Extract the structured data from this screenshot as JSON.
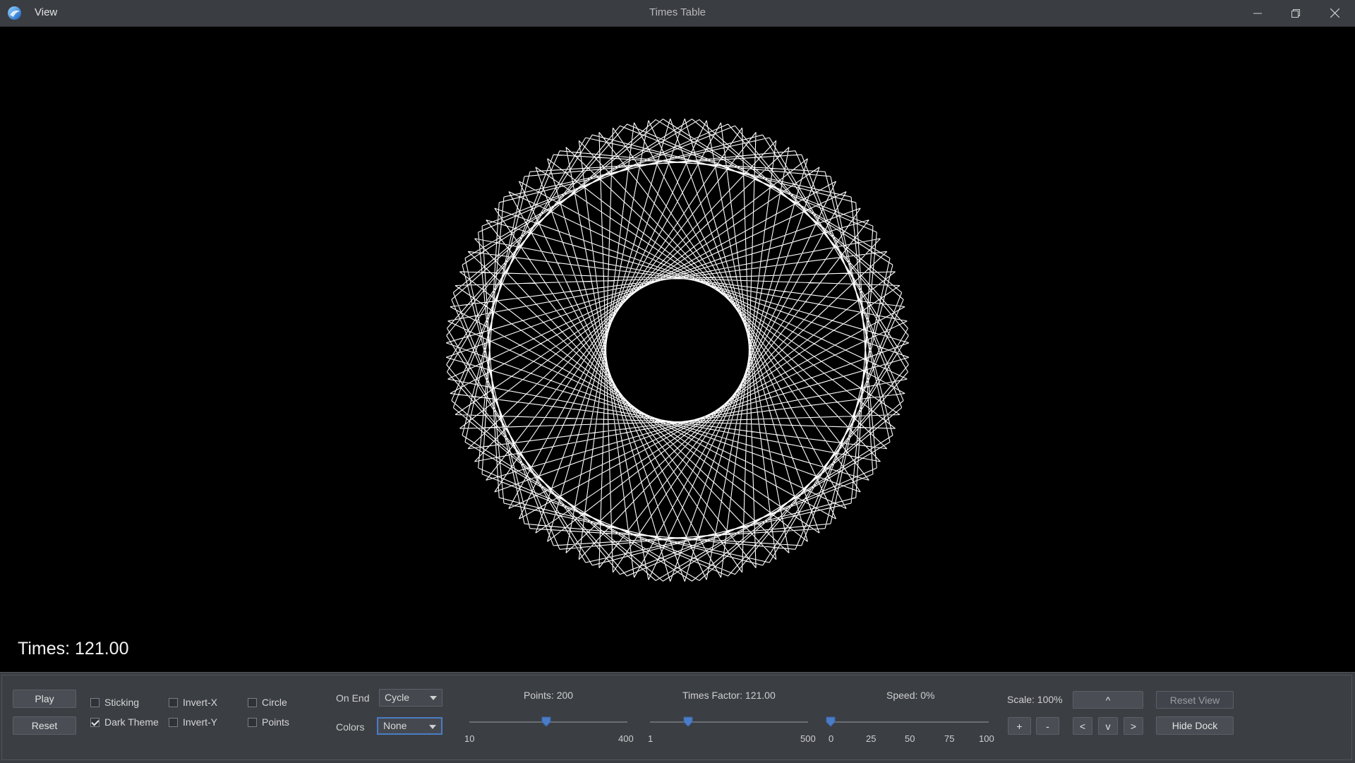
{
  "window": {
    "menu_view": "View",
    "title": "Times Table"
  },
  "canvas": {
    "times_text": "Times: 121.00",
    "points": 200,
    "times": 121,
    "stroke_color": "#ffffff",
    "background": "#000000"
  },
  "dock": {
    "play_label": "Play",
    "reset_label": "Reset",
    "checkboxes": {
      "sticking": {
        "label": "Sticking",
        "checked": false
      },
      "dark_theme": {
        "label": "Dark Theme",
        "checked": true
      },
      "invert_x": {
        "label": "Invert-X",
        "checked": false
      },
      "invert_y": {
        "label": "Invert-Y",
        "checked": false
      },
      "circle": {
        "label": "Circle",
        "checked": false
      },
      "points": {
        "label": "Points",
        "checked": false
      }
    },
    "on_end": {
      "label": "On End",
      "value": "Cycle"
    },
    "colors": {
      "label": "Colors",
      "value": "None"
    },
    "points_slider": {
      "label": "Points: 200",
      "min": "10",
      "max": "400",
      "value": 200
    },
    "times_slider": {
      "label": "Times Factor: 121.00",
      "min": "1",
      "max": "500",
      "value": 121
    },
    "speed_slider": {
      "label": "Speed: 0%",
      "ticks": [
        "0",
        "25",
        "50",
        "75",
        "100"
      ],
      "value": 0
    },
    "scale_label": "Scale: 100%",
    "zoom_in": "+",
    "zoom_out": "-",
    "pan_up": "^",
    "pan_left": "<",
    "pan_down": "v",
    "pan_right": ">",
    "reset_view": "Reset View",
    "hide_dock": "Hide Dock"
  },
  "colors": {
    "accent": "#4a7cc7",
    "dock_bg": "#3b3e43",
    "titlebar_bg": "#3a3d42"
  }
}
